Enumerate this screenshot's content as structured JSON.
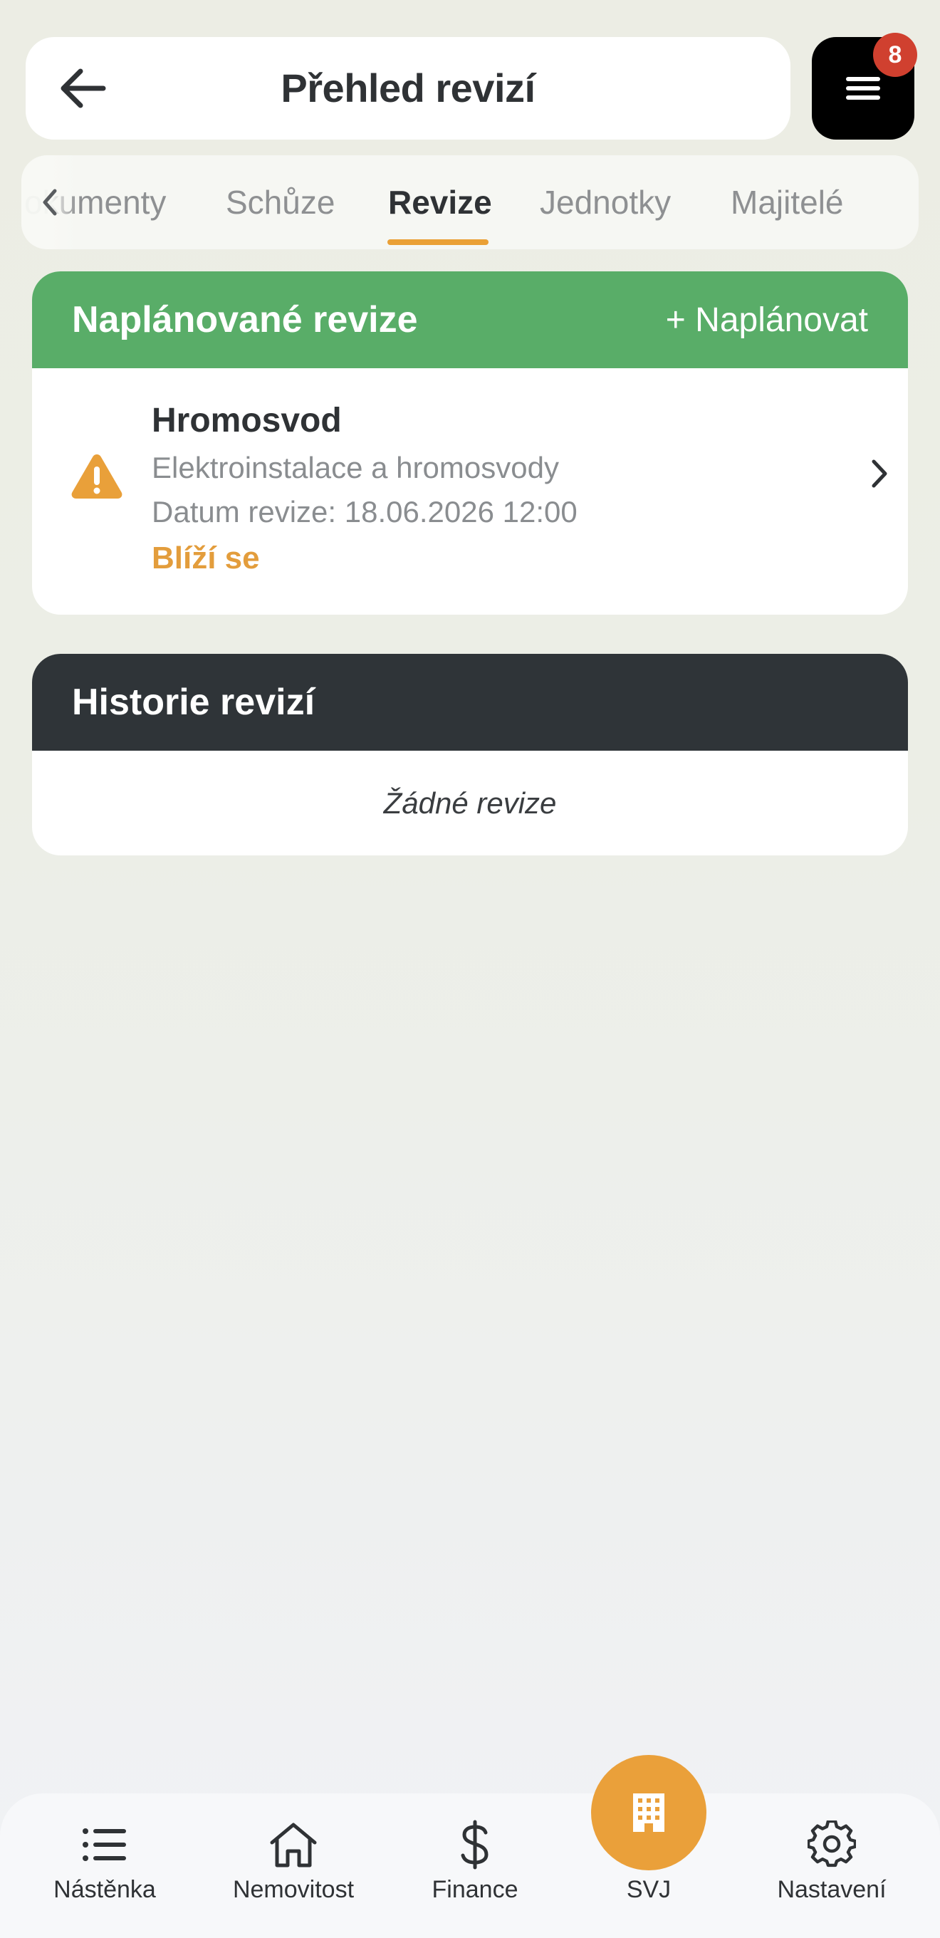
{
  "header": {
    "title": "Přehled revizí",
    "back_icon": "arrow-left-icon",
    "menu_icon": "hamburger-icon",
    "menu_badge": "8"
  },
  "tabs": {
    "items": [
      {
        "label": "okumenty"
      },
      {
        "label": "Schůze"
      },
      {
        "label": "Revize"
      },
      {
        "label": "Jednotky"
      },
      {
        "label": "Majitelé"
      }
    ],
    "active_index": 2,
    "scroll_icon": "chevron-left-icon"
  },
  "planned": {
    "title": "Naplánované revize",
    "action_label": "+ Naplánovat",
    "items": [
      {
        "name": "Hromosvod",
        "category": "Elektroinstalace a hromosvody",
        "date_line": "Datum revize: 18.06.2026 12:00",
        "status": "Blíží se",
        "icon": "warning-icon"
      }
    ]
  },
  "history": {
    "title": "Historie revizí",
    "empty_text": "Žádné revize"
  },
  "bottom_nav": {
    "items": [
      {
        "label": "Nástěnka",
        "icon": "list-icon"
      },
      {
        "label": "Nemovitost",
        "icon": "house-icon"
      },
      {
        "label": "Finance",
        "icon": "dollar-icon"
      },
      {
        "label": "SVJ",
        "icon": "building-icon"
      },
      {
        "label": "Nastavení",
        "icon": "gear-icon"
      }
    ],
    "active_index": 3
  },
  "colors": {
    "accent": "#eaa036",
    "planned_header": "#59ad68",
    "history_header": "#2f3438",
    "badge": "#d0402f",
    "status_warning": "#e39d3c"
  }
}
